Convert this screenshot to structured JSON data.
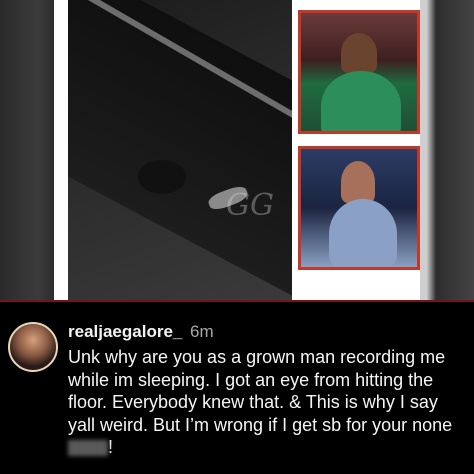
{
  "comment": {
    "username": "realjaegalore_",
    "time": "6m",
    "text_before_censor": "Unk why are you as a grown man recording me while im sleeping. I got an eye from hitting the floor. Everybody knew that. & This is why I say yall weird. But I’m wrong if I get sb for your none",
    "text_after_censor": "!"
  },
  "image": {
    "watermark": "GG"
  }
}
